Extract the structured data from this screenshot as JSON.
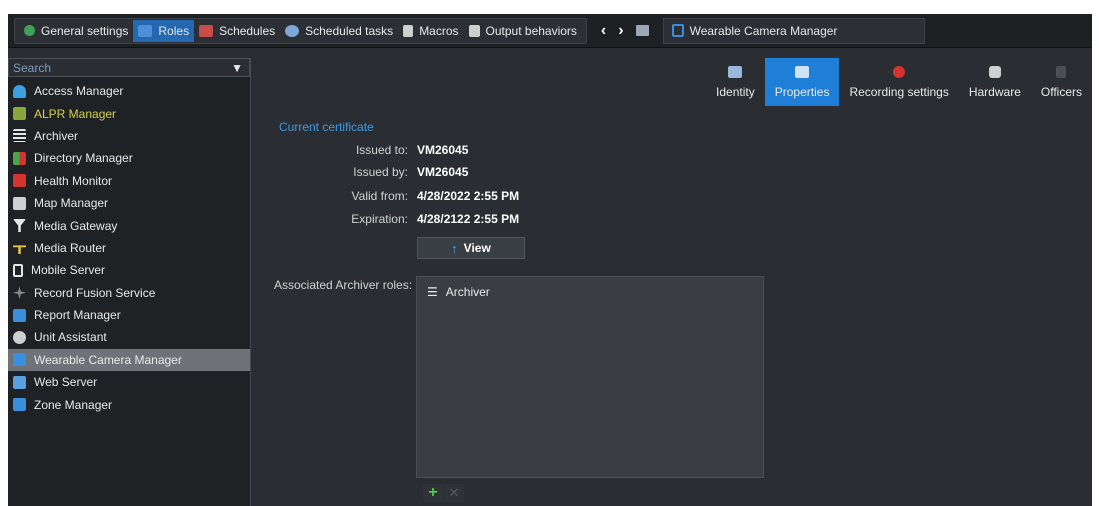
{
  "toolbar": {
    "items": [
      {
        "label": "General settings",
        "icon": "gear-icon",
        "color": "#3fa05a"
      },
      {
        "label": "Roles",
        "icon": "roles-icon",
        "color": "#4b8fd8",
        "active": true
      },
      {
        "label": "Schedules",
        "icon": "calendar-icon",
        "color": "#c94b4b"
      },
      {
        "label": "Scheduled tasks",
        "icon": "scheduled-task-icon",
        "color": "#7fa8d8"
      },
      {
        "label": "Macros",
        "icon": "macro-icon",
        "color": "#e6e6e6"
      },
      {
        "label": "Output behaviors",
        "icon": "output-icon",
        "color": "#e6e6e6"
      }
    ],
    "back_glyph": "‹",
    "forward_glyph": "›",
    "breadcrumb": "Wearable Camera Manager"
  },
  "sidebar": {
    "search_placeholder": "Search",
    "roles": [
      {
        "label": "Access Manager",
        "icon": "access-manager-icon",
        "color": "#3aa0e0"
      },
      {
        "label": "ALPR Manager",
        "icon": "alpr-manager-icon",
        "color": "#8aa53a",
        "highlight": true
      },
      {
        "label": "Archiver",
        "icon": "archiver-icon",
        "color": "#e6e6e6"
      },
      {
        "label": "Directory Manager",
        "icon": "directory-manager-icon",
        "color": "#d4342f"
      },
      {
        "label": "Health Monitor",
        "icon": "health-monitor-icon",
        "color": "#d4342f"
      },
      {
        "label": "Map Manager",
        "icon": "map-manager-icon",
        "color": "#cfcfcf"
      },
      {
        "label": "Media Gateway",
        "icon": "media-gateway-icon",
        "color": "#e6e6e6"
      },
      {
        "label": "Media Router",
        "icon": "media-router-icon",
        "color": "#e0c33a"
      },
      {
        "label": "Mobile Server",
        "icon": "mobile-server-icon",
        "color": "#e6e6e6"
      },
      {
        "label": "Record Fusion Service",
        "icon": "record-fusion-icon",
        "color": "#8a8a8a"
      },
      {
        "label": "Report Manager",
        "icon": "report-manager-icon",
        "color": "#3a8fdc"
      },
      {
        "label": "Unit Assistant",
        "icon": "unit-assistant-icon",
        "color": "#cfcfcf"
      },
      {
        "label": "Wearable Camera Manager",
        "icon": "wearable-camera-icon",
        "color": "#3a8fdc",
        "selected": true
      },
      {
        "label": "Web Server",
        "icon": "web-server-icon",
        "color": "#5aa0e0"
      },
      {
        "label": "Zone Manager",
        "icon": "zone-manager-icon",
        "color": "#3a8fdc"
      }
    ]
  },
  "tabs": [
    {
      "label": "Identity",
      "icon": "identity-icon"
    },
    {
      "label": "Properties",
      "icon": "properties-icon",
      "active": true
    },
    {
      "label": "Recording settings",
      "icon": "recording-icon"
    },
    {
      "label": "Hardware",
      "icon": "hardware-icon"
    },
    {
      "label": "Officers",
      "icon": "officers-icon"
    }
  ],
  "certificate": {
    "section_title": "Current certificate",
    "issued_to_label": "Issued to:",
    "issued_to": "VM26045",
    "issued_by_label": "Issued by:",
    "issued_by": "VM26045",
    "valid_from_label": "Valid from:",
    "valid_from": "4/28/2022 2:55 PM",
    "expiration_label": "Expiration:",
    "expiration": "4/28/2122 2:55 PM",
    "view_button": "View"
  },
  "associated": {
    "label": "Associated Archiver roles:",
    "items": [
      {
        "label": "Archiver",
        "icon": "archiver-icon"
      }
    ],
    "add_glyph": "+",
    "remove_glyph": "✕"
  }
}
